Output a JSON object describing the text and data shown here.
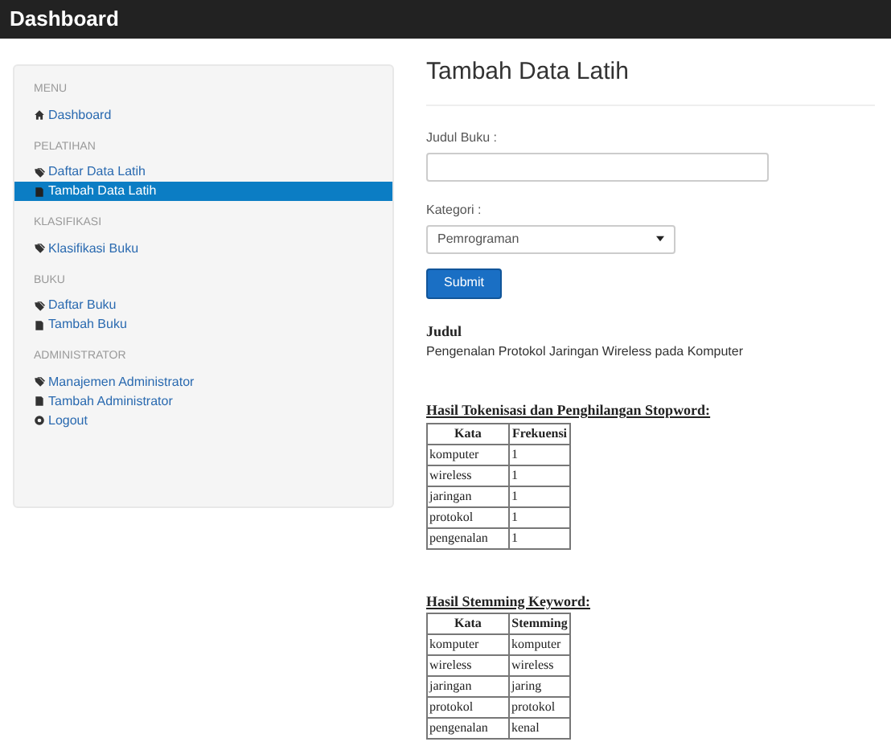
{
  "navbar": {
    "brand": "Dashboard"
  },
  "sidebar": {
    "sections": [
      {
        "heading": "MENU",
        "items": [
          {
            "label": "Dashboard",
            "kind": "home",
            "selected": false
          }
        ]
      },
      {
        "heading": "PELATIHAN",
        "items": [
          {
            "label": "Daftar Data Latih",
            "kind": "list",
            "selected": false
          },
          {
            "label": "Tambah Data Latih",
            "kind": "add",
            "selected": true
          }
        ]
      },
      {
        "heading": "KLASIFIKASI",
        "items": [
          {
            "label": "Klasifikasi Buku",
            "kind": "list",
            "selected": false
          }
        ]
      },
      {
        "heading": "BUKU",
        "items": [
          {
            "label": "Daftar Buku",
            "kind": "list",
            "selected": false
          },
          {
            "label": "Tambah Buku",
            "kind": "add",
            "selected": false
          }
        ]
      },
      {
        "heading": "ADMINISTRATOR",
        "items": [
          {
            "label": "Manajemen Administrator",
            "kind": "list",
            "selected": false
          },
          {
            "label": "Tambah Administrator",
            "kind": "add",
            "selected": false
          },
          {
            "label": "Logout",
            "kind": "logout",
            "selected": false
          }
        ]
      }
    ]
  },
  "main": {
    "title": "Tambah Data Latih",
    "form": {
      "title_label": "Judul Buku :",
      "category_label": "Kategori :",
      "category_value": "Pemrograman",
      "submit": "Submit"
    },
    "result": {
      "label": "Judul",
      "text": "Pengenalan Protokol Jaringan Wireless pada Komputer"
    },
    "tables": [
      {
        "heading": "Hasil Tokenisasi dan Penghilangan Stopword:",
        "columns": [
          "Kata",
          "Frekuensi"
        ],
        "rows": [
          [
            "komputer",
            "1"
          ],
          [
            "wireless",
            "1"
          ],
          [
            "jaringan",
            "1"
          ],
          [
            "protokol",
            "1"
          ],
          [
            "pengenalan",
            "1"
          ]
        ]
      },
      {
        "heading": "Hasil Stemming Keyword:",
        "columns": [
          "Kata",
          "Stemming"
        ],
        "rows": [
          [
            "komputer",
            "komputer"
          ],
          [
            "wireless",
            "wireless"
          ],
          [
            "jaringan",
            "jaring"
          ],
          [
            "protokol",
            "protokol"
          ],
          [
            "pengenalan",
            "kenal"
          ]
        ]
      }
    ]
  }
}
